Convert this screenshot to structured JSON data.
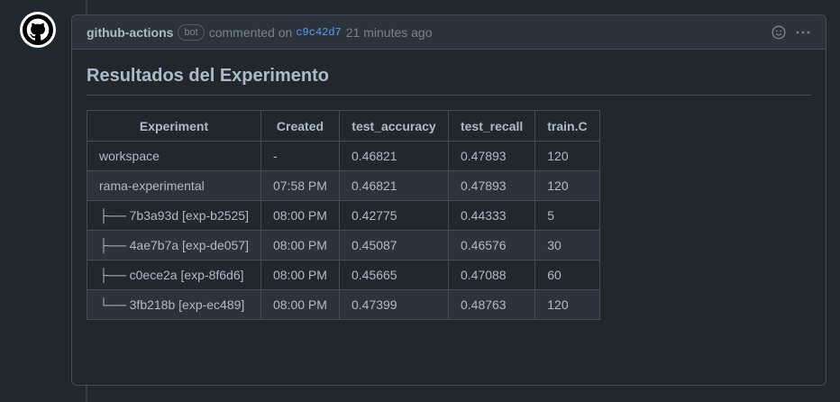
{
  "comment": {
    "author": "github-actions",
    "badge": "bot",
    "action_text": "commented on",
    "commit_sha": "c9c42d7",
    "timestamp": "21 minutes ago"
  },
  "body": {
    "heading": "Resultados del Experimento",
    "table": {
      "headers": [
        "Experiment",
        "Created",
        "test_accuracy",
        "test_recall",
        "train.C"
      ],
      "rows": [
        [
          "workspace",
          "-",
          "0.46821",
          "0.47893",
          "120"
        ],
        [
          "rama-experimental",
          "07:58 PM",
          "0.46821",
          "0.47893",
          "120"
        ],
        [
          "├── 7b3a93d [exp-b2525]",
          "08:00 PM",
          "0.42775",
          "0.44333",
          "5"
        ],
        [
          "├── 4ae7b7a [exp-de057]",
          "08:00 PM",
          "0.45087",
          "0.46576",
          "30"
        ],
        [
          "├── c0ece2a [exp-8f6d6]",
          "08:00 PM",
          "0.45665",
          "0.47088",
          "60"
        ],
        [
          "└── 3fb218b [exp-ec489]",
          "08:00 PM",
          "0.47399",
          "0.48763",
          "120"
        ]
      ]
    }
  },
  "icons": {
    "avatar": "github-logo-icon",
    "reaction": "smiley-icon",
    "menu": "kebab-menu-icon"
  },
  "colors": {
    "background": "#22272e",
    "header_bg": "#2d333b",
    "border": "#444c56",
    "link": "#539bf5"
  }
}
